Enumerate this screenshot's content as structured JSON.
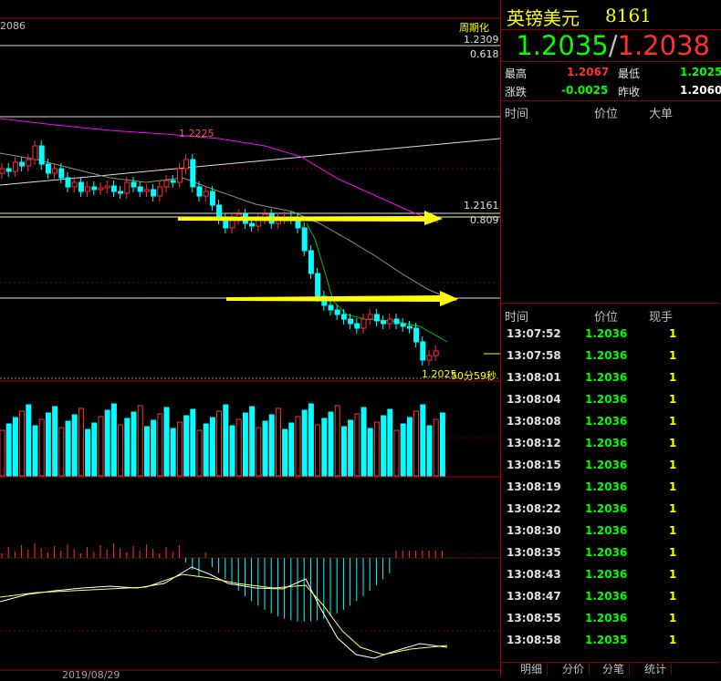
{
  "chart": {
    "top_left_price": "2086",
    "period_label": "周期化",
    "level_1": "1.2309",
    "fib_1": "0.618",
    "high_marker": "1.2225",
    "level_2": "1.2161",
    "fib_2": "0.809",
    "last_price_label": "1.2025",
    "countdown": "50分59秒",
    "date_label": "2019/08/29",
    "colors": {
      "up": "#ff3030",
      "down": "#00ffff",
      "ma_magenta": "#ff00ff",
      "ma_green": "#00c000",
      "arrow": "#ffff00"
    }
  },
  "panel": {
    "name": "英镑美元",
    "code": "8161",
    "bid": "1.2035",
    "ask": "1.2038",
    "stats": {
      "high_label": "最高",
      "high_value": "1.2067",
      "low_label": "最低",
      "low_value": "1.2025",
      "change_label": "涨跌",
      "change_value": "-0.0025",
      "prev_close_label": "昨收",
      "prev_close_value": "1.2060"
    },
    "big_orders_headers": [
      "时间",
      "价位",
      "大单"
    ],
    "tick_headers": [
      "时间",
      "价位",
      "现手"
    ],
    "ticks": [
      {
        "time": "13:07:52",
        "price": "1.2036",
        "vol": "1"
      },
      {
        "time": "13:07:58",
        "price": "1.2036",
        "vol": "1"
      },
      {
        "time": "13:08:01",
        "price": "1.2036",
        "vol": "1"
      },
      {
        "time": "13:08:04",
        "price": "1.2036",
        "vol": "1"
      },
      {
        "time": "13:08:08",
        "price": "1.2036",
        "vol": "1"
      },
      {
        "time": "13:08:12",
        "price": "1.2036",
        "vol": "1"
      },
      {
        "time": "13:08:15",
        "price": "1.2036",
        "vol": "1"
      },
      {
        "time": "13:08:19",
        "price": "1.2036",
        "vol": "1"
      },
      {
        "time": "13:08:22",
        "price": "1.2036",
        "vol": "1"
      },
      {
        "time": "13:08:30",
        "price": "1.2036",
        "vol": "1"
      },
      {
        "time": "13:08:35",
        "price": "1.2036",
        "vol": "1"
      },
      {
        "time": "13:08:43",
        "price": "1.2036",
        "vol": "1"
      },
      {
        "time": "13:08:47",
        "price": "1.2036",
        "vol": "1"
      },
      {
        "time": "13:08:55",
        "price": "1.2036",
        "vol": "1"
      },
      {
        "time": "13:08:58",
        "price": "1.2035",
        "vol": "1"
      }
    ],
    "tabs": [
      "明细",
      "分价",
      "分笔",
      "统计"
    ]
  }
}
